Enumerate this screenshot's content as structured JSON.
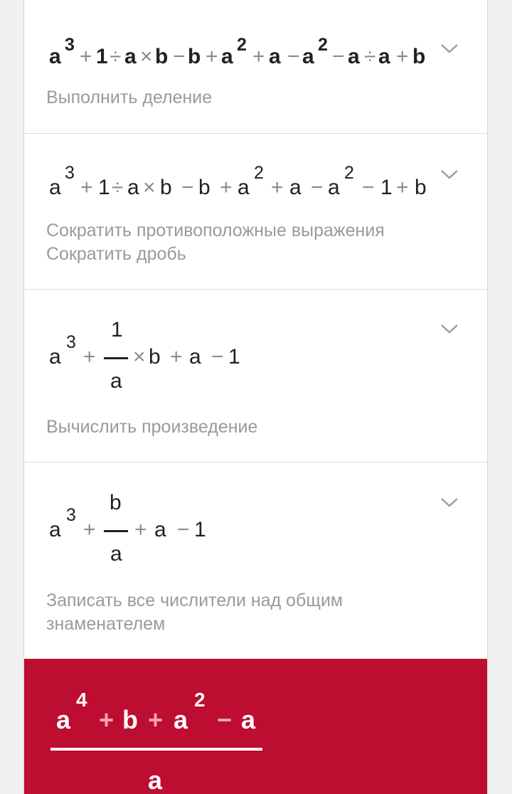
{
  "steps": [
    {
      "expression": [
        "a",
        "3",
        "+",
        "1",
        "÷",
        "a",
        "×",
        "b",
        "−",
        "b",
        "+",
        "a",
        "2",
        "+",
        "a",
        "−",
        "a",
        "2",
        "−",
        "a",
        "÷",
        "a",
        "+",
        "b"
      ],
      "descriptions": [
        "Выполнить деление"
      ]
    },
    {
      "expression": [
        "a",
        "3",
        "+",
        "1",
        "÷",
        "a",
        "×",
        "b",
        "−",
        "b",
        "+",
        "a",
        "2",
        "+",
        "a",
        "−",
        "a",
        "2",
        "−",
        "1",
        "+",
        "b"
      ],
      "descriptions": [
        "Сократить противоположные выражения",
        "Сократить дробь"
      ]
    },
    {
      "expression": {
        "base": "a",
        "exp": "3",
        "plus": "+",
        "num": "1",
        "den": "a",
        "times": "×",
        "b": "b",
        "plus2": "+",
        "a2": "a",
        "minus": "−",
        "one": "1"
      },
      "descriptions": [
        "Вычислить произведение"
      ]
    },
    {
      "expression": {
        "base": "a",
        "exp": "3",
        "plus": "+",
        "num": "b",
        "den": "a",
        "plus2": "+",
        "a2": "a",
        "minus": "−",
        "one": "1"
      },
      "descriptions": [
        "Записать все числители над общим знаменателем"
      ]
    }
  ],
  "result": {
    "numerator": [
      "a",
      "4",
      "+",
      "b",
      "+",
      "a",
      "2",
      "−",
      "a"
    ],
    "denominator": "a"
  },
  "icons": {
    "expand": "chevron-down-icon"
  },
  "colors": {
    "result_bg": "#bd0d30",
    "operator_grey": "#8a8a8a",
    "description_grey": "#9a9a9a"
  }
}
